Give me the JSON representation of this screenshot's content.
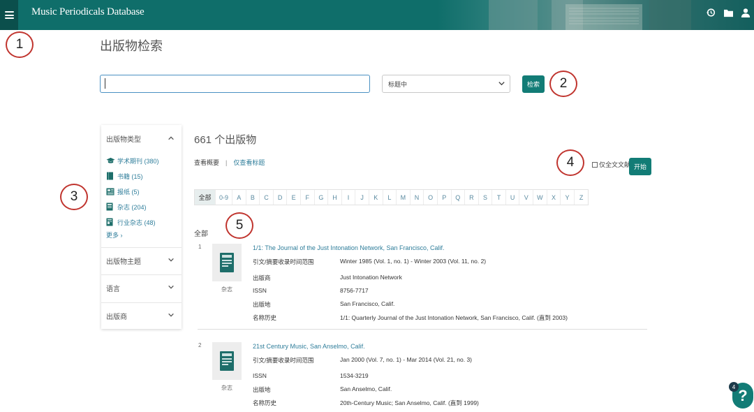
{
  "header": {
    "title": "Music Periodicals Database",
    "icons": [
      "menu-icon",
      "history-icon",
      "folder-icon",
      "user-icon"
    ],
    "brand_color": "#0f6e6a"
  },
  "annotations": [
    "1",
    "2",
    "3",
    "4",
    "5"
  ],
  "search": {
    "page_title": "出版物检索",
    "input_value": "",
    "scope_selected": "标题中",
    "button_label": "检索"
  },
  "sidebar": {
    "type_heading": "出版物类型",
    "types": [
      {
        "label": "学术期刊 (380)",
        "icon": "scholarly-journal-icon"
      },
      {
        "label": "书籍 (15)",
        "icon": "book-icon"
      },
      {
        "label": "报纸 (5)",
        "icon": "newspaper-icon"
      },
      {
        "label": "杂志 (204)",
        "icon": "magazine-icon"
      },
      {
        "label": "行业杂志 (48)",
        "icon": "trade-journal-icon"
      }
    ],
    "more": "更多 ›",
    "subject_heading": "出版物主题",
    "language_heading": "语言",
    "publisher_heading": "出版商"
  },
  "results": {
    "count": "661 个出版物",
    "view_summary": "查看概要",
    "separator": "|",
    "view_titles": "仅查看标题",
    "fulltext_label": "仅全文文献",
    "go_button": "开始",
    "alphabet": [
      "全部",
      "0-9",
      "A",
      "B",
      "C",
      "D",
      "E",
      "F",
      "G",
      "H",
      "I",
      "J",
      "K",
      "L",
      "M",
      "N",
      "O",
      "P",
      "Q",
      "R",
      "S",
      "T",
      "U",
      "V",
      "W",
      "X",
      "Y",
      "Z"
    ],
    "section_label": "全部",
    "records": [
      {
        "num": "1",
        "type": "杂志",
        "title": "1/1: The Journal of the Just Intonation Network, San Francisco, Calif.",
        "fields": [
          {
            "label": "引文/摘要收录时间范围",
            "value": "Winter 1985 (Vol. 1, no. 1) - Winter 2003 (Vol. 11, no. 2)"
          },
          {
            "label": "出版商",
            "value": "Just Intonation Network"
          },
          {
            "label": "ISSN",
            "value": "8756-7717"
          },
          {
            "label": "出版地",
            "value": "San Francisco, Calif."
          },
          {
            "label": "名称历史",
            "value": "1/1: Quarterly Journal of the Just Intonation Network, San Francisco, Calif. (直到 2003)"
          }
        ]
      },
      {
        "num": "2",
        "type": "杂志",
        "title": "21st Century Music, San Anselmo, Calif.",
        "fields": [
          {
            "label": "引文/摘要收录时间范围",
            "value": "Jan 2000 (Vol. 7, no. 1) - Mar 2014 (Vol. 21, no. 3)"
          },
          {
            "label": "ISSN",
            "value": "1534-3219"
          },
          {
            "label": "出版地",
            "value": "San Anselmo, Calif."
          },
          {
            "label": "名称历史",
            "value": "20th-Century Music; San Anselmo, Calif. (直到 1999)"
          }
        ]
      }
    ]
  },
  "help": {
    "badge": "4",
    "label": "?"
  }
}
